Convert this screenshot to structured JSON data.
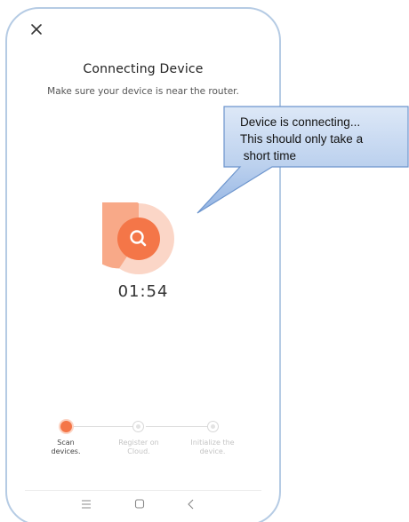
{
  "screen": {
    "title": "Connecting Device",
    "subtitle": "Make sure your device is near the router."
  },
  "icons": {
    "close": "close-icon",
    "scan": "search-icon",
    "nav_menu": "menu-icon",
    "nav_home": "home-square-icon",
    "nav_back": "back-chevron-icon"
  },
  "timer": "01:54",
  "steps": [
    {
      "label": "Scan\ndevices.",
      "state": "active"
    },
    {
      "label": "Register on\nCloud.",
      "state": "pending"
    },
    {
      "label": "Initialize the\ndevice.",
      "state": "pending"
    }
  ],
  "callout": {
    "line1": "Device is connecting...",
    "line2": "This should only take a",
    "line3": " short time"
  },
  "colors": {
    "accent": "#f47648",
    "accent_light": "#fcd3c3",
    "callout_fill_top": "#dbe7f6",
    "callout_fill_bottom": "#9bbbe6",
    "callout_border": "#6d95cd"
  }
}
